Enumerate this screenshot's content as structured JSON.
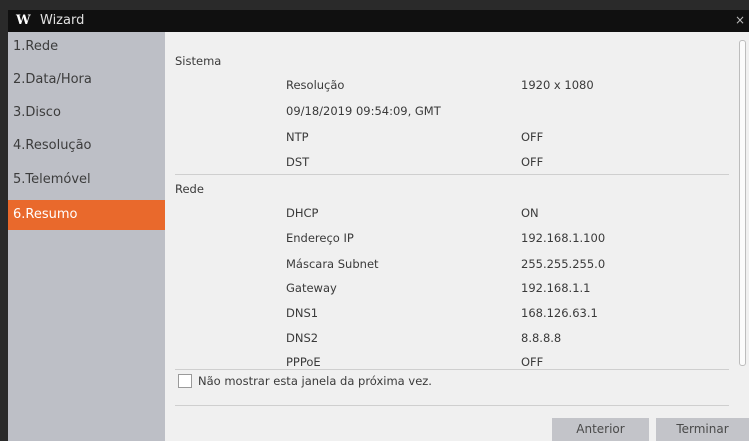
{
  "window": {
    "logo": "W",
    "title": "Wizard",
    "close_glyph": "×"
  },
  "sidebar": {
    "items": [
      {
        "label": "1.Rede"
      },
      {
        "label": "2.Data/Hora"
      },
      {
        "label": "3.Disco"
      },
      {
        "label": "4.Resolução"
      },
      {
        "label": "5.Telemóvel"
      },
      {
        "label": "6.Resumo"
      }
    ]
  },
  "summary": {
    "sistema": {
      "title": "Sistema",
      "resolucao_label": "Resolução",
      "resolucao_value": "1920 x 1080",
      "datetime": "09/18/2019 09:54:09, GMT",
      "ntp_label": "NTP",
      "ntp_value": "OFF",
      "dst_label": "DST",
      "dst_value": "OFF"
    },
    "rede": {
      "title": "Rede",
      "dhcp_label": "DHCP",
      "dhcp_value": "ON",
      "ip_label": "Endereço IP",
      "ip_value": "192.168.1.100",
      "mask_label": "Máscara Subnet",
      "mask_value": "255.255.255.0",
      "gateway_label": "Gateway",
      "gateway_value": "192.168.1.1",
      "dns1_label": "DNS1",
      "dns1_value": "168.126.63.1",
      "dns2_label": "DNS2",
      "dns2_value": "8.8.8.8",
      "pppoe_label": "PPPoE",
      "pppoe_value": "OFF"
    }
  },
  "footer": {
    "checkbox_label": "Não mostrar esta janela da próxima vez.",
    "back_label": "Anterior",
    "finish_label": "Terminar"
  },
  "colors": {
    "accent": "#e9692c",
    "titlebar": "#101010",
    "sidebar": "#bdbfc6"
  }
}
